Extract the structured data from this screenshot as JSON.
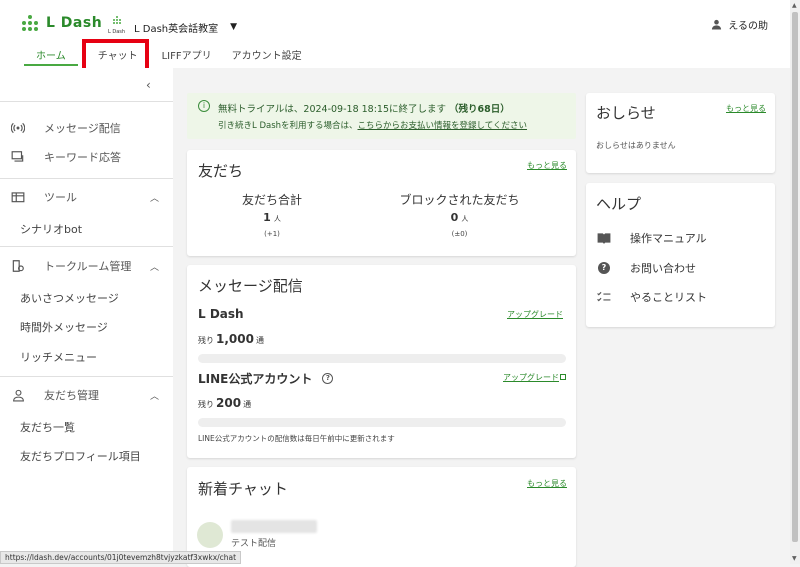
{
  "header": {
    "logo_text": "L Dash",
    "account": {
      "mini_logo": "L Dash",
      "name": "L Dash英会話教室"
    },
    "user_name": "えるの助",
    "tabs": [
      {
        "label": "ホーム",
        "active": true
      },
      {
        "label": "チャット",
        "active": false
      },
      {
        "label": "LIFFアプリ",
        "active": false
      },
      {
        "label": "アカウント設定",
        "active": false
      }
    ]
  },
  "sidebar": {
    "items": [
      {
        "label": "メッセージ配信",
        "icon": "broadcast-icon"
      },
      {
        "label": "キーワード応答",
        "icon": "keyword-reply-icon"
      },
      {
        "label": "ツール",
        "icon": "tools-icon"
      },
      {
        "label": "トークルーム管理",
        "icon": "talkroom-icon"
      },
      {
        "label": "友だち管理",
        "icon": "person-icon"
      }
    ],
    "sub": {
      "tools": [
        "シナリオbot"
      ],
      "talkroom": [
        "あいさつメッセージ",
        "時間外メッセージ",
        "リッチメニュー"
      ],
      "friends": [
        "友だち一覧",
        "友だちプロフィール項目"
      ]
    }
  },
  "trial": {
    "line1_prefix": "無料トライアルは、2024-09-18 18:15に終了します",
    "line1_bold": "（残り68日）",
    "line2_prefix": "引き続きL Dashを利用する場合は、",
    "line2_link": "こちらからお支払い情報を登録してください"
  },
  "friends": {
    "title": "友だち",
    "more": "もっと見る",
    "total_label": "友だち合計",
    "total_value": "1",
    "total_unit": "人",
    "total_diff": "(+1)",
    "blocked_label": "ブロックされた友だち",
    "blocked_value": "0",
    "blocked_unit": "人",
    "blocked_diff": "(±0)"
  },
  "messages": {
    "title": "メッセージ配信",
    "ldash_label": "L Dash",
    "upgrade": "アップグレード",
    "remaining_prefix": "残り",
    "ldash_remaining": "1,000",
    "unit": "通",
    "ldash_usage": 0,
    "line_label": "LINE公式アカウント",
    "line_upgrade": "アップグレード",
    "line_remaining": "200",
    "line_usage": 0,
    "note": "LINE公式アカウントの配信数は毎日午前中に更新されます"
  },
  "chat": {
    "title": "新着チャット",
    "more": "もっと見る",
    "preview": "テスト配信"
  },
  "news": {
    "title": "おしらせ",
    "more": "もっと見る",
    "empty": "おしらせはありません"
  },
  "help": {
    "title": "ヘルプ",
    "items": [
      {
        "label": "操作マニュアル",
        "icon": "manual-book-icon"
      },
      {
        "label": "お問い合わせ",
        "icon": "question-icon"
      },
      {
        "label": "やることリスト",
        "icon": "checklist-icon"
      }
    ]
  },
  "status_url": "https://ldash.dev/accounts/01j0tevemzh8tvjyzkatf3xwkx/chat",
  "colors": {
    "brand_green": "#49a942",
    "highlight_red": "#e60012",
    "trial_bg": "#eef6e8"
  }
}
